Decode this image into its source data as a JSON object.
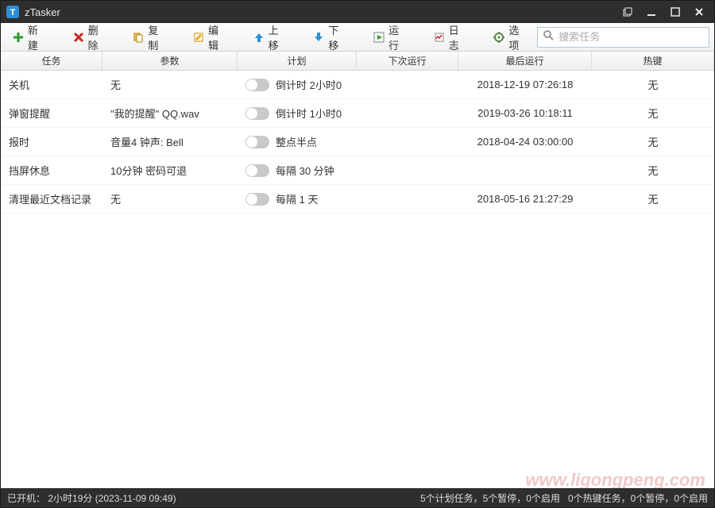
{
  "window": {
    "title": "zTasker"
  },
  "toolbar": {
    "new": "新建",
    "delete": "删除",
    "copy": "复制",
    "edit": "编辑",
    "moveup": "上移",
    "movedown": "下移",
    "run": "运行",
    "log": "日志",
    "options": "选项",
    "search_placeholder": "搜索任务"
  },
  "columns": {
    "task": "任务",
    "param": "参数",
    "plan": "计划",
    "next": "下次运行",
    "last": "最后运行",
    "hotkey": "热键"
  },
  "rows": [
    {
      "task": "关机",
      "param": "无",
      "plan": "倒计时 2小时0",
      "next": "",
      "last": "2018-12-19 07:26:18",
      "hotkey": "无"
    },
    {
      "task": "弹窗提醒",
      "param": "\"我的提醒\" QQ.wav",
      "plan": "倒计时 1小时0",
      "next": "",
      "last": "2019-03-26 10:18:11",
      "hotkey": "无"
    },
    {
      "task": "报时",
      "param": "音量4 钟声: Bell",
      "plan": "整点半点",
      "next": "",
      "last": "2018-04-24 03:00:00",
      "hotkey": "无"
    },
    {
      "task": "挡屏休息",
      "param": "10分钟 密码可退",
      "plan": "每隔 30 分钟",
      "next": "",
      "last": "",
      "hotkey": "无"
    },
    {
      "task": "清理最近文档记录",
      "param": "无",
      "plan": "每隔 1 天",
      "next": "",
      "last": "2018-05-16 21:27:29",
      "hotkey": "无"
    }
  ],
  "status": {
    "uptime_label": "已开机：",
    "uptime_value": "2小时19分 (2023-11-09 09:49)",
    "plan_summary": "5个计划任务，5个暂停，0个启用",
    "hot_summary": "0个热键任务，0个暂停，0个启用"
  },
  "watermark": "www.ligongpeng.com"
}
